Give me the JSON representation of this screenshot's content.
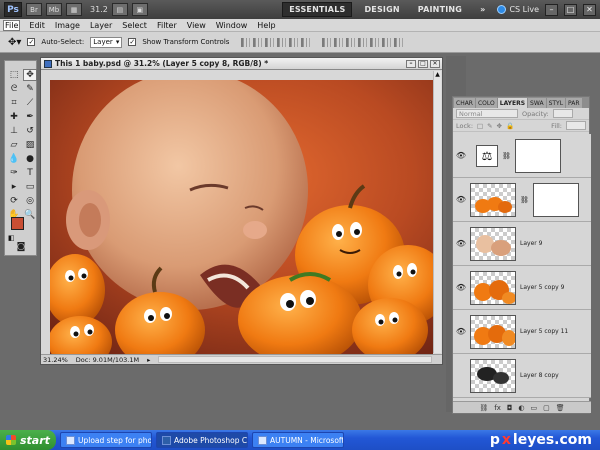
{
  "appbar": {
    "logo": "Ps",
    "icon_br": "Br",
    "icon_mb": "Mb",
    "zoom": "31.2",
    "workspaces": [
      "ESSENTIALS",
      "DESIGN",
      "PAINTING"
    ],
    "more": "»",
    "cs_live": "CS Live"
  },
  "menu": [
    "File",
    "Edit",
    "Image",
    "Layer",
    "Select",
    "Filter",
    "View",
    "Window",
    "Help"
  ],
  "options": {
    "auto_select_label": "Auto-Select:",
    "auto_select_value": "Layer",
    "transform_label": "Show Transform Controls"
  },
  "document": {
    "title": "This 1 baby.psd @ 31.2% (Layer 5 copy 8, RGB/8) *",
    "zoom_status": "31.24%",
    "doc_status": "Doc: 9.01M/103.1M"
  },
  "tools": {
    "fg_color": "#c94e33",
    "bg_color": "#ffffff"
  },
  "panels": {
    "tabs": [
      "CHAR",
      "COLO",
      "LAYERS",
      "SWA",
      "STYL",
      "PAR"
    ],
    "blend_mode": "Normal",
    "opacity_label": "Opacity:",
    "lock_label": "Lock:",
    "fill_label": "Fill:",
    "layers": [
      {
        "name": "",
        "kind": "adjustment"
      },
      {
        "name": "",
        "kind": "masked"
      },
      {
        "name": "Layer 9"
      },
      {
        "name": "Layer 5 copy 9"
      },
      {
        "name": "Layer 5 copy 11"
      },
      {
        "name": "Layer 8 copy"
      }
    ]
  },
  "taskbar": {
    "start": "start",
    "tasks": [
      "Upload step for phot...",
      "Adobe Photoshop CS5",
      "AUTUMN - Microsoft ..."
    ],
    "brand_a": "p",
    "brand_x": "x",
    "brand_b": "leyes.com"
  }
}
